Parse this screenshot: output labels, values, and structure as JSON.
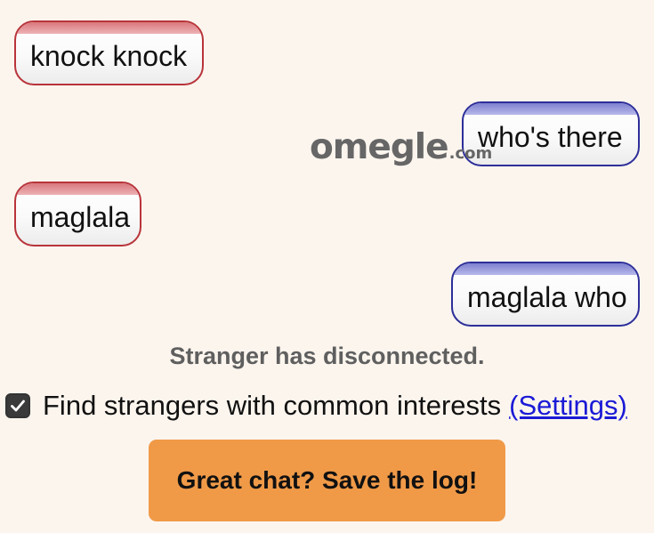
{
  "chat": {
    "messages": [
      {
        "sender": "stranger",
        "text": "knock knock"
      },
      {
        "sender": "you",
        "text": "who's there"
      },
      {
        "sender": "stranger",
        "text": "maglala"
      },
      {
        "sender": "you",
        "text": "maglala who"
      }
    ]
  },
  "logo": {
    "main": "omegle",
    "suffix": ".com"
  },
  "status": {
    "text": "Stranger has disconnected."
  },
  "interests": {
    "checked": true,
    "label": "Find strangers with common interests",
    "settings_link": "(Settings)"
  },
  "save_log": {
    "label": "Great chat? Save the log!"
  },
  "colors": {
    "background": "#fcf5ee",
    "stranger_border": "#b8343a",
    "you_border": "#2d2f9a",
    "button": "#f09a48",
    "link": "#1a1ad6",
    "logo": "#666666"
  }
}
